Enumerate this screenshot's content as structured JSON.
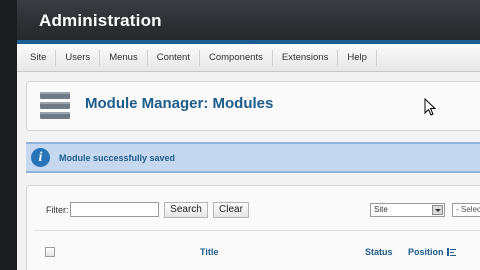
{
  "header": {
    "title": "Administration"
  },
  "menu": {
    "items": [
      "Site",
      "Users",
      "Menus",
      "Content",
      "Components",
      "Extensions",
      "Help"
    ]
  },
  "toolbar": {
    "icon": "module-icon",
    "title": "Module Manager: Modules"
  },
  "message": {
    "icon": "info-icon",
    "text": "Module successfully saved"
  },
  "filter": {
    "label": "Filter:",
    "value": "",
    "search_label": "Search",
    "clear_label": "Clear",
    "site_select": "Site",
    "second_select": "- Select"
  },
  "table": {
    "headers": {
      "title": "Title",
      "status": "Status",
      "position": "Position"
    }
  },
  "colors": {
    "header": "#2b2d31",
    "accent": "#1d5c8b",
    "message_bg": "#c6d8ef"
  }
}
